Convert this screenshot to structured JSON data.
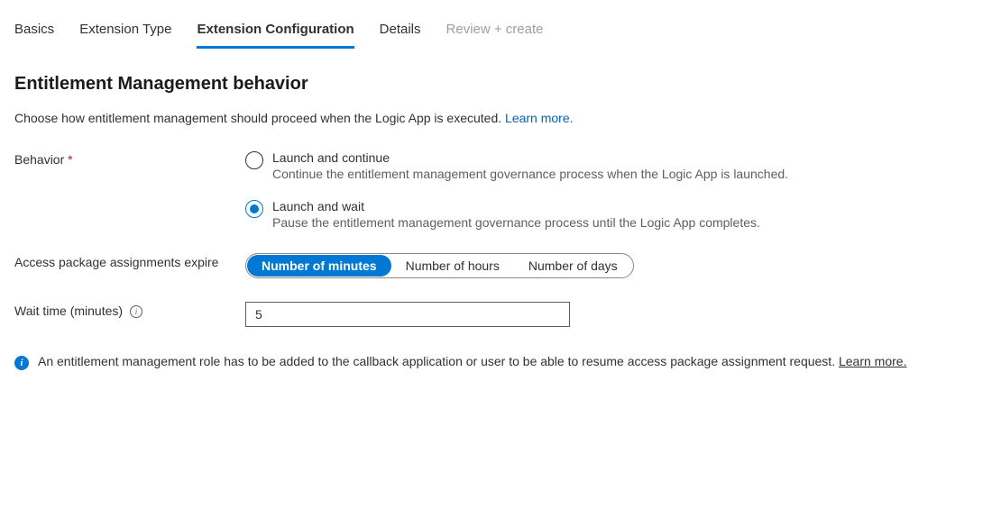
{
  "tabs": {
    "basics": "Basics",
    "extension_type": "Extension Type",
    "extension_configuration": "Extension Configuration",
    "details": "Details",
    "review_create": "Review + create"
  },
  "section": {
    "title": "Entitlement Management behavior",
    "description": "Choose how entitlement management should proceed when the Logic App is executed. ",
    "learn_more": "Learn more."
  },
  "behavior": {
    "label": "Behavior ",
    "required_marker": "*",
    "options": {
      "launch_continue": {
        "title": "Launch and continue",
        "desc": "Continue the entitlement management governance process when the Logic App is launched."
      },
      "launch_wait": {
        "title": "Launch and wait",
        "desc": "Pause the entitlement management governance process until the Logic App completes."
      }
    }
  },
  "expire": {
    "label": "Access package assignments expire",
    "options": {
      "minutes": "Number of minutes",
      "hours": "Number of hours",
      "days": "Number of days"
    }
  },
  "wait_time": {
    "label": "Wait time (minutes) ",
    "value": "5"
  },
  "info_banner": {
    "text": "An entitlement management role has to be added to the callback application or user to be able to resume access package assignment request. ",
    "learn_more": "Learn more."
  }
}
